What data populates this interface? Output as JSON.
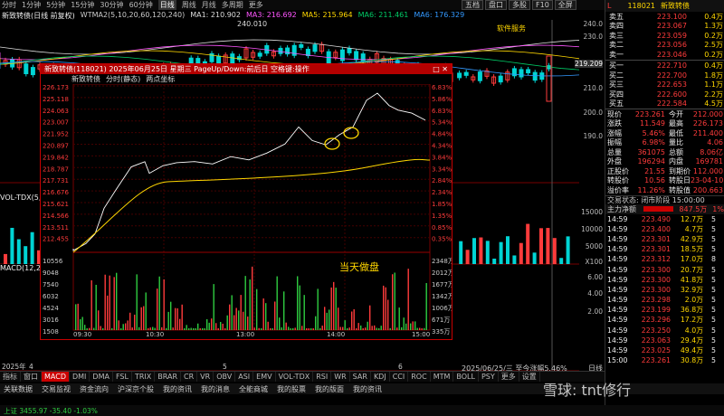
{
  "topbar": {
    "items": [
      "分时",
      "1分钟",
      "5分钟",
      "15分钟",
      "30分钟",
      "60分钟",
      "日线",
      "周线",
      "月线",
      "多周期",
      "更多"
    ],
    "active_index": 6,
    "right_buttons": [
      "五档",
      "盘口",
      "多股",
      "F10",
      "全屏"
    ]
  },
  "main_chart": {
    "stock_name": "新致转债(日线 前复权)",
    "ma_legend": [
      {
        "label": "WTMA2(5,10,20,60,120,240)",
        "color": "#cccccc"
      },
      {
        "label": "MA1: 210.902",
        "color": "#dddddd"
      },
      {
        "label": "MA3: 216.692",
        "color": "#ff55ff"
      },
      {
        "label": "MA5: 215.964",
        "color": "#ffd700"
      },
      {
        "label": "MA6: 211.461",
        "color": "#00cc66"
      },
      {
        "label": "MA6: 176.329",
        "color": "#3399ff"
      }
    ],
    "high_label": "240.010",
    "annotation": "软件服务",
    "axis_labels": [
      "240.0",
      "230.0",
      "219.209",
      "210.0",
      "200.0",
      "190.0"
    ],
    "volume_label": "VOL-TDX(5,10)",
    "macd_label": "MACD(12,26,9)",
    "vol_axis": [
      "15000",
      "10000",
      "5000",
      "X100"
    ],
    "macd_axis": [
      "6.00",
      "4.00",
      "2.00"
    ],
    "date_labels": [
      "2025年",
      "4",
      "5",
      "6"
    ],
    "date_info": "2025/06/25/三 至今涨幅5.46%",
    "period_label": "日线"
  },
  "popup": {
    "title": "新致转债(118021) 2025年06月25日 星期三 PageUp/Down:前后日 空格键:操作",
    "subtitle": [
      "新致转债",
      "分时(静态)",
      "两点坐标"
    ],
    "annotation": "当天做盘",
    "left_axis": [
      "226.173",
      "225.118",
      "224.063",
      "223.007",
      "221.952",
      "220.897",
      "219.842",
      "218.787",
      "217.731",
      "216.676",
      "215.621",
      "214.566",
      "213.511",
      "212.455"
    ],
    "right_axis": [
      "6.83%",
      "5.86%",
      "6.83%",
      "5.34%",
      "4.84%",
      "4.34%",
      "3.84%",
      "3.34%",
      "2.84%",
      "2.34%",
      "1.85%",
      "1.35%",
      "0.85%",
      "0.35%"
    ],
    "vol_left": [
      "10556",
      "9048",
      "7540",
      "6032",
      "4524",
      "3016",
      "1508"
    ],
    "vol_right": [
      "2348万",
      "2012万",
      "1677万",
      "1342万",
      "1006万",
      "671万",
      "335万"
    ],
    "times": [
      "09:30",
      "10:30",
      "13:00",
      "14:00",
      "15:00"
    ]
  },
  "right_panel": {
    "code": "118021",
    "name": "新致转债",
    "sell": [
      {
        "label": "卖五",
        "price": "223.100",
        "vol": "0.4万"
      },
      {
        "label": "卖四",
        "price": "223.067",
        "vol": "1.3万"
      },
      {
        "label": "卖三",
        "price": "223.059",
        "vol": "0.2万"
      },
      {
        "label": "卖二",
        "price": "223.056",
        "vol": "2.5万"
      },
      {
        "label": "卖一",
        "price": "223.046",
        "vol": "0.2万"
      }
    ],
    "buy": [
      {
        "label": "买一",
        "price": "222.710",
        "vol": "0.4万"
      },
      {
        "label": "买二",
        "price": "222.700",
        "vol": "1.8万"
      },
      {
        "label": "买三",
        "price": "222.653",
        "vol": "1.1万"
      },
      {
        "label": "买四",
        "price": "222.600",
        "vol": "2.2万"
      },
      {
        "label": "买五",
        "price": "222.584",
        "vol": "4.5万"
      }
    ],
    "stats": [
      {
        "l1": "现价",
        "v1": "223.261",
        "l2": "今开",
        "v2": "212.000"
      },
      {
        "l1": "涨跌",
        "v1": "11.549",
        "l2": "最高",
        "v2": "226.173"
      },
      {
        "l1": "涨幅",
        "v1": "5.46%",
        "l2": "最低",
        "v2": "211.400"
      },
      {
        "l1": "振幅",
        "v1": "6.98%",
        "l2": "量比",
        "v2": "4.06"
      },
      {
        "l1": "总量",
        "v1": "361075",
        "l2": "总额",
        "v2": "8.06亿"
      },
      {
        "l1": "外盘",
        "v1": "196294",
        "l2": "内盘",
        "v2": "169781"
      },
      {
        "l1": "正股价",
        "v1": "21.55",
        "l2": "到期价",
        "v2": "112.000"
      },
      {
        "l1": "转股价",
        "v1": "10.56",
        "l2": "转股日",
        "v2": "23-04-10"
      },
      {
        "l1": "溢价率",
        "v1": "11.26%",
        "l2": "转股值",
        "v2": "200.663"
      }
    ],
    "trade_status": "交易状态: 闭市阶段 15:00:00",
    "net_inflow_label": "主力净额",
    "net_inflow_value": "847.5万",
    "net_inflow_pct": "1%",
    "ticks": [
      {
        "t": "14:59",
        "p": "223.490",
        "v": "12.7万",
        "n": "5"
      },
      {
        "t": "14:59",
        "p": "223.400",
        "v": "4.7万",
        "n": "5"
      },
      {
        "t": "14:59",
        "p": "223.301",
        "v": "42.9万",
        "n": "5"
      },
      {
        "t": "14:59",
        "p": "223.301",
        "v": "18.5万",
        "n": "5"
      },
      {
        "t": "14:59",
        "p": "223.312",
        "v": "17.0万",
        "n": "8"
      },
      {
        "t": "14:59",
        "p": "223.300",
        "v": "20.7万",
        "n": "5"
      },
      {
        "t": "14:59",
        "p": "223.300",
        "v": "41.8万",
        "n": "5"
      },
      {
        "t": "14:59",
        "p": "223.300",
        "v": "32.9万",
        "n": "5"
      },
      {
        "t": "14:59",
        "p": "223.298",
        "v": "2.0万",
        "n": "5"
      },
      {
        "t": "14:59",
        "p": "223.199",
        "v": "36.8万",
        "n": "5"
      },
      {
        "t": "14:59",
        "p": "223.296",
        "v": "17.2万",
        "n": "5"
      },
      {
        "t": "14:59",
        "p": "223.250",
        "v": "4.0万",
        "n": "5"
      },
      {
        "t": "14:59",
        "p": "223.063",
        "v": "29.4万",
        "n": "5"
      },
      {
        "t": "14:59",
        "p": "223.025",
        "v": "49.4万",
        "n": "5"
      },
      {
        "t": "15:00",
        "p": "223.261",
        "v": "30.8万",
        "n": "5"
      }
    ]
  },
  "bottom_tabs": [
    "指标",
    "窗口",
    "MACD",
    "DMI",
    "DMA",
    "FSL",
    "TRIX",
    "BRAR",
    "CR",
    "VR",
    "OBV",
    "ASI",
    "EMV",
    "VOL-TDX",
    "RSI",
    "WR",
    "SAR",
    "KDJ",
    "CCI",
    "ROC",
    "MTM",
    "BOLL",
    "PSY",
    "更多",
    "设置"
  ],
  "bottom_active": "MACD",
  "footbar": [
    "关联数据",
    "交易监视",
    "资金流向",
    "沪深京个股",
    "我的资讯",
    "我的消息",
    "全能商城",
    "我的股票",
    "我的版面",
    "我的资讯"
  ],
  "status_text": "上证 3455.97  -35.40  -1.03%",
  "watermark": "雪球: tnt修行"
}
